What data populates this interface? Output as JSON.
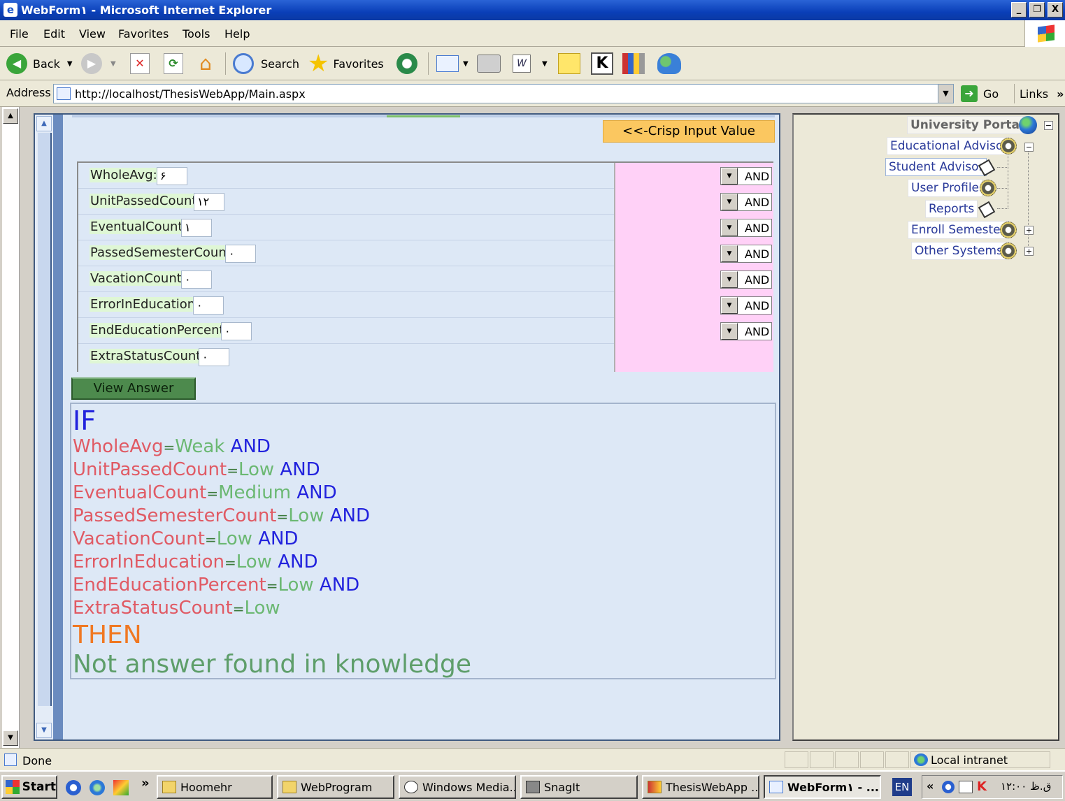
{
  "window": {
    "title": "WebForm١ - Microsoft Internet Explorer",
    "minimize": "_",
    "maximize": "❐",
    "close": "X"
  },
  "menu": [
    "File",
    "Edit",
    "View",
    "Favorites",
    "Tools",
    "Help"
  ],
  "toolbar": {
    "back": "Back",
    "search": "Search",
    "favorites": "Favorites"
  },
  "address": {
    "label": "Address",
    "url": "http://localhost/ThesisWebApp/Main.aspx",
    "go": "Go",
    "links": "Links"
  },
  "form": {
    "crisp_button": "<<-Crisp Input Value",
    "view_answer": "View Answer",
    "rows": [
      {
        "label": "WholeAvg:",
        "value": "۶",
        "op": "AND"
      },
      {
        "label": "UnitPassedCount:",
        "value": "١٢",
        "op": "AND"
      },
      {
        "label": "EventualCount:",
        "value": "١",
        "op": "AND"
      },
      {
        "label": "PassedSemesterCount:",
        "value": "٠",
        "op": "AND"
      },
      {
        "label": "VacationCount:",
        "value": "٠",
        "op": "AND"
      },
      {
        "label": "ErrorInEducation:",
        "value": "٠",
        "op": "AND"
      },
      {
        "label": "EndEducationPercent:",
        "value": "٠",
        "op": "AND"
      },
      {
        "label": "ExtraStatusCount:",
        "value": "٠",
        "op": ""
      }
    ]
  },
  "rule": {
    "if": "IF",
    "then": "THEN",
    "answer": "Not answer found in knowledge",
    "eq": "=",
    "clauses": [
      {
        "var": "WholeAvg",
        "val": "Weak",
        "op": "AND"
      },
      {
        "var": "UnitPassedCount",
        "val": "Low",
        "op": "AND"
      },
      {
        "var": "EventualCount",
        "val": "Medium",
        "op": "AND"
      },
      {
        "var": "PassedSemesterCount",
        "val": "Low",
        "op": "AND"
      },
      {
        "var": "VacationCount",
        "val": "Low",
        "op": "AND"
      },
      {
        "var": "ErrorInEducation",
        "val": "Low",
        "op": "AND"
      },
      {
        "var": "EndEducationPercent",
        "val": "Low",
        "op": "AND"
      },
      {
        "var": "ExtraStatusCount",
        "val": "Low",
        "op": ""
      }
    ]
  },
  "tree": {
    "root": "University Portal",
    "items": [
      {
        "label": "Educational Advisor",
        "icon": "gear-icon",
        "expander": "−"
      },
      {
        "label": "Student Advisor",
        "icon": "document-icon",
        "expander": ""
      },
      {
        "label": "User Profile",
        "icon": "gear-icon",
        "expander": ""
      },
      {
        "label": "Reports",
        "icon": "document-icon",
        "expander": ""
      },
      {
        "label": "Enroll Semester",
        "icon": "gear-icon",
        "expander": "+"
      },
      {
        "label": "Other Systems",
        "icon": "gear-icon",
        "expander": "+"
      }
    ],
    "root_expander": "−"
  },
  "status": {
    "text": "Done",
    "zone": "Local intranet"
  },
  "taskbar": {
    "start": "Start",
    "chevron": "»",
    "tasks": [
      "Hoomehr",
      "WebProgram",
      "Windows Media...",
      "SnagIt",
      "ThesisWebApp ...",
      "WebForm١ - ..."
    ],
    "lang": "EN",
    "tray_chevron": "«",
    "clock": "ق.ظ ١٢:٠٠"
  }
}
